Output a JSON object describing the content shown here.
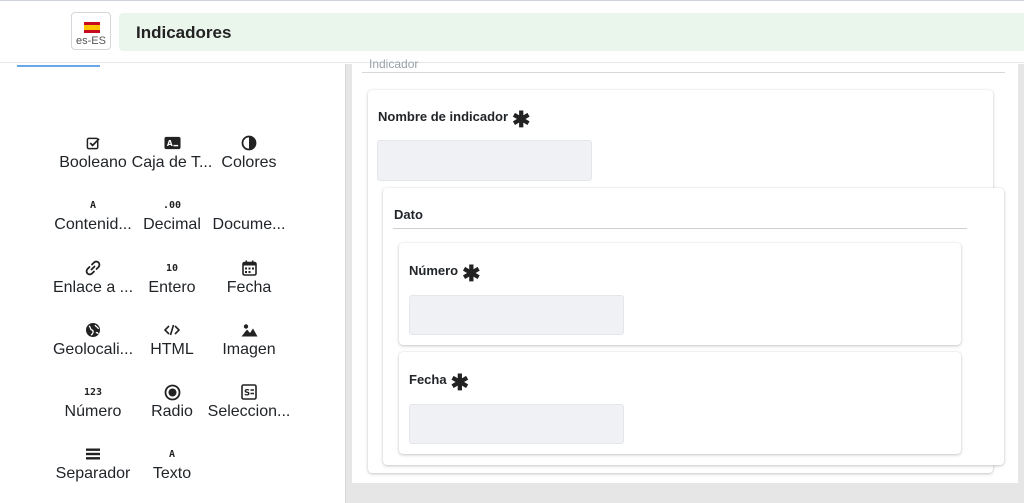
{
  "header": {
    "language_code": "es-ES",
    "title": "Indicadores"
  },
  "palette": {
    "items": [
      {
        "label": "Booleano",
        "icon": "checkbox-icon"
      },
      {
        "label": "Caja de T...",
        "icon": "textbox-icon"
      },
      {
        "label": "Colores",
        "icon": "contrast-icon"
      },
      {
        "label": "Contenid...",
        "icon": "text-a-icon",
        "icon_text": "A"
      },
      {
        "label": "Decimal",
        "icon": "decimal-icon",
        "icon_text": ".00"
      },
      {
        "label": "Docume...",
        "icon": "document-icon"
      },
      {
        "label": "Enlace a ...",
        "icon": "link-icon"
      },
      {
        "label": "Entero",
        "icon": "integer-icon",
        "icon_text": "10"
      },
      {
        "label": "Fecha",
        "icon": "calendar-icon"
      },
      {
        "label": "Geolocali...",
        "icon": "globe-icon"
      },
      {
        "label": "HTML",
        "icon": "code-icon"
      },
      {
        "label": "Imagen",
        "icon": "image-icon"
      },
      {
        "label": "Número",
        "icon": "number-icon",
        "icon_text": "123"
      },
      {
        "label": "Radio",
        "icon": "radio-icon"
      },
      {
        "label": "Seleccion...",
        "icon": "select-icon"
      },
      {
        "label": "Separador",
        "icon": "separator-icon"
      },
      {
        "label": "Texto",
        "icon": "text-icon",
        "icon_text": "A"
      }
    ]
  },
  "form": {
    "cut_label": "Indicador",
    "indicator_field": {
      "label": "Nombre de indicador",
      "required": "✱",
      "value": ""
    },
    "dato": {
      "label": "Dato",
      "numero_field": {
        "label": "Número",
        "required": "✱",
        "value": ""
      },
      "fecha_field": {
        "label": "Fecha",
        "required": "✱",
        "value": ""
      }
    }
  },
  "colors": {
    "title_bar_bg": "#eaf5ec",
    "tab_underline": "#6aa7e8",
    "canvas_bg": "#e6e6e6"
  }
}
